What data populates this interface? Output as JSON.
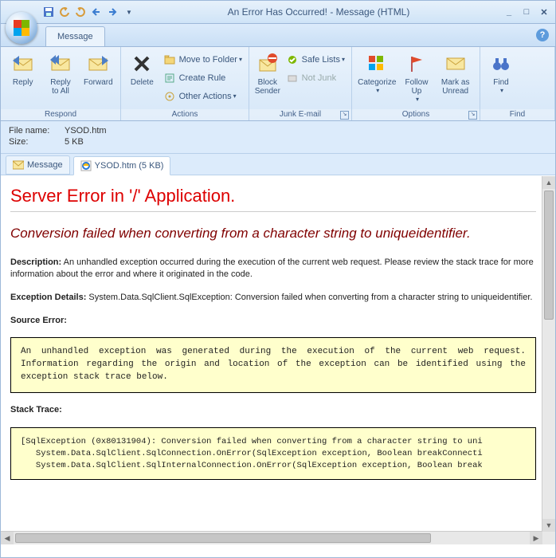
{
  "titlebar": {
    "title": "An Error Has Occurred! - Message (HTML)"
  },
  "tab": {
    "message": "Message"
  },
  "ribbon": {
    "respond": {
      "title": "Respond",
      "reply": "Reply",
      "reply_all": "Reply\nto All",
      "forward": "Forward"
    },
    "actions": {
      "title": "Actions",
      "delete": "Delete",
      "move": "Move to Folder",
      "create_rule": "Create Rule",
      "other": "Other Actions"
    },
    "junk": {
      "title": "Junk E-mail",
      "block": "Block\nSender",
      "safe": "Safe Lists",
      "not_junk": "Not Junk"
    },
    "options": {
      "title": "Options",
      "categorize": "Categorize",
      "followup": "Follow\nUp",
      "unread": "Mark as\nUnread"
    },
    "find": {
      "title": "Find",
      "find": "Find"
    }
  },
  "header": {
    "filename_label": "File name:",
    "filename": "YSOD.htm",
    "size_label": "Size:",
    "size": "5 KB"
  },
  "attach_tabs": {
    "message": "Message",
    "file": "YSOD.htm (5 KB)"
  },
  "ysod": {
    "h1": "Server Error in '/' Application.",
    "h2": "Conversion failed when converting from a character string to uniqueidentifier.",
    "desc_label": "Description:",
    "desc": "An unhandled exception occurred during the execution of the current web request. Please review the stack trace for more information about the error and where it originated in the code.",
    "exc_label": "Exception Details:",
    "exc": "System.Data.SqlClient.SqlException: Conversion failed when converting from a character string to uniqueidentifier.",
    "src_label": "Source Error:",
    "src_box": "An unhandled exception was generated during the execution of the current web request. Information regarding the origin and location of the exception can be identified using the exception stack trace below.",
    "stack_label": "Stack Trace:",
    "stack_box": "[SqlException (0x80131904): Conversion failed when converting from a character string to uni\n   System.Data.SqlClient.SqlConnection.OnError(SqlException exception, Boolean breakConnecti\n   System.Data.SqlClient.SqlInternalConnection.OnError(SqlException exception, Boolean break"
  }
}
